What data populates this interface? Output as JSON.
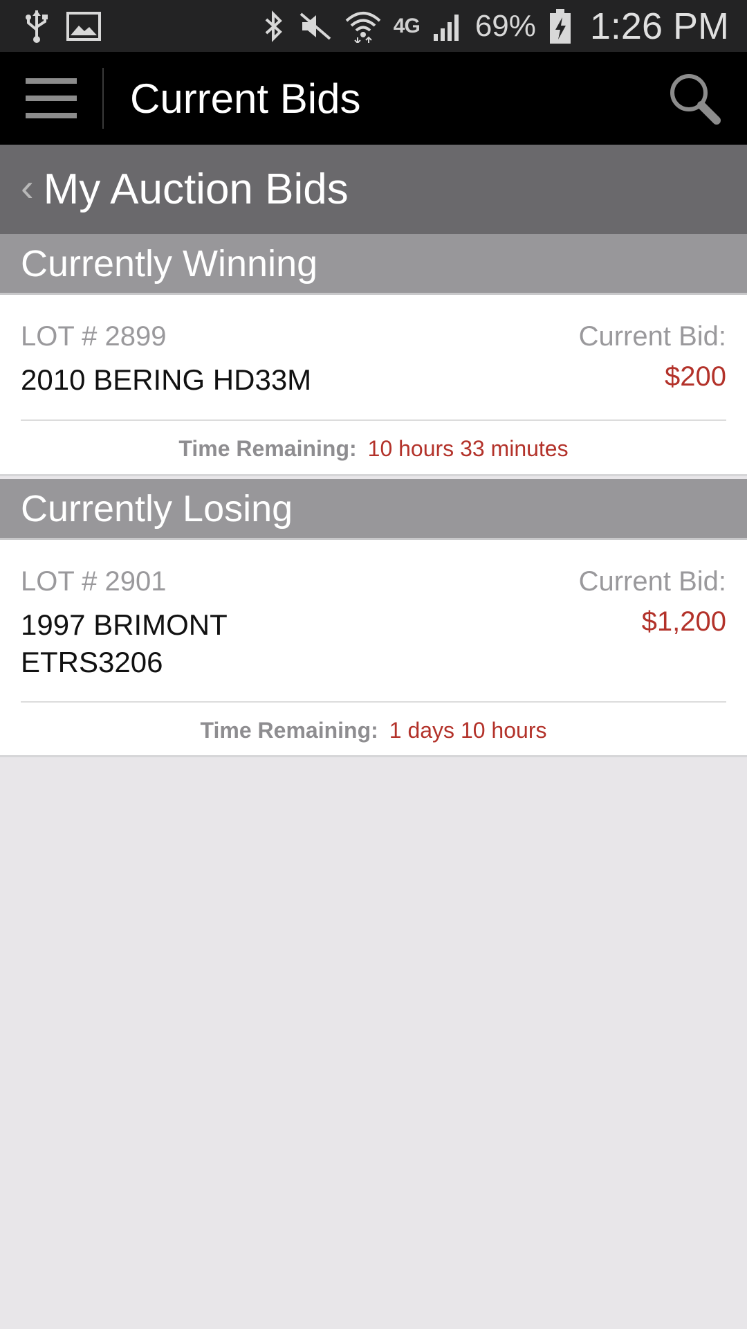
{
  "status_bar": {
    "battery": "69%",
    "time": "1:26 PM",
    "network": "4G",
    "icons": [
      "usb-icon",
      "image-icon",
      "bluetooth-icon",
      "mute-icon",
      "wifi-icon",
      "network-4g-icon",
      "signal-icon",
      "battery-icon"
    ]
  },
  "action_bar": {
    "title": "Current Bids",
    "menu_icon": "hamburger-menu-icon",
    "search_icon": "search-icon"
  },
  "sub_header": {
    "back_icon": "chevron-left-icon",
    "title": "My Auction Bids"
  },
  "sections": [
    {
      "title": "Currently Winning",
      "item": {
        "lot": "LOT # 2899",
        "name": "2010 BERING HD33M",
        "bid_label": "Current Bid:",
        "bid_value": "$200",
        "time_label": "Time Remaining:",
        "time_value": "10 hours 33 minutes"
      }
    },
    {
      "title": "Currently Losing",
      "item": {
        "lot": "LOT # 2901",
        "name_line1": "1997 BRIMONT",
        "name_line2": "ETRS3206",
        "bid_label": "Current Bid:",
        "bid_value": "$1,200",
        "time_label": "Time Remaining:",
        "time_value": "1 days 10 hours"
      }
    }
  ],
  "colors": {
    "accent_red": "#b3322a",
    "action_bar": "#000000",
    "sub_header": "#6a696c",
    "section_header": "#98979a",
    "background": "#e8e6e9"
  }
}
